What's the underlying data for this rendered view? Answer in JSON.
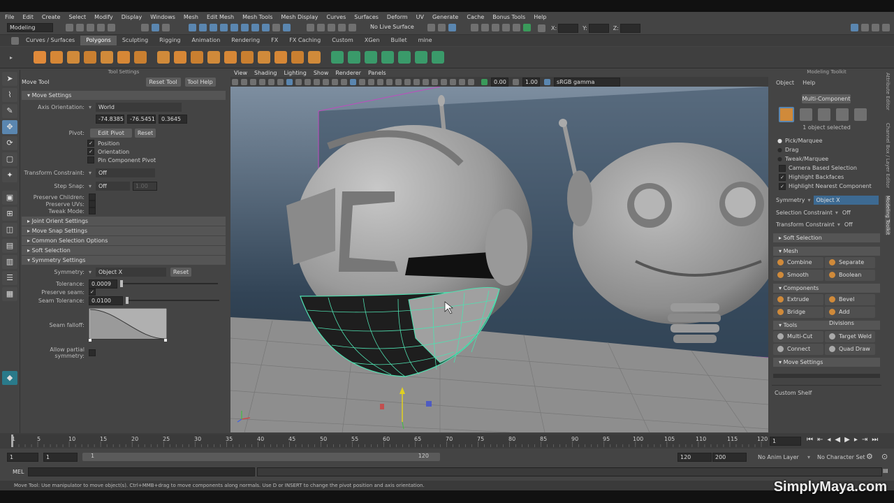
{
  "menubar": [
    "File",
    "Edit",
    "Create",
    "Select",
    "Modify",
    "Display",
    "Windows",
    "Mesh",
    "Edit Mesh",
    "Mesh Tools",
    "Mesh Display",
    "Curves",
    "Surfaces",
    "Deform",
    "UV",
    "Generate",
    "Cache",
    "Bonus Tools",
    "Help"
  ],
  "status": {
    "mode": "Modeling",
    "live_surface": "No Live Surface",
    "coord_x": "X:",
    "coord_y": "Y:",
    "coord_z": "Z:"
  },
  "shelf_tabs": [
    "Curves / Surfaces",
    "Polygons",
    "Sculpting",
    "Rigging",
    "Animation",
    "Rendering",
    "FX",
    "FX Caching",
    "Custom",
    "XGen",
    "Bullet",
    "mine"
  ],
  "active_shelf_tab": "Polygons",
  "tool_settings": {
    "panel_title": "Tool Settings",
    "tool_name": "Move Tool",
    "reset_tool": "Reset Tool",
    "tool_help": "Tool Help",
    "move_settings": "Move Settings",
    "axis_orientation_label": "Axis Orientation:",
    "axis_orientation_value": "World",
    "coords": [
      "-74.8385",
      "-76.5451",
      "0.3645"
    ],
    "pivot_label": "Pivot:",
    "edit_pivot": "Edit Pivot",
    "reset": "Reset",
    "position": "Position",
    "orientation": "Orientation",
    "pin_component_pivot": "Pin Component Pivot",
    "transform_constraint_label": "Transform Constraint:",
    "transform_constraint_value": "Off",
    "step_snap_label": "Step Snap:",
    "step_snap_value": "Off",
    "step_snap_amount": "1.00",
    "preserve_children": "Preserve Children:",
    "preserve_uvs": "Preserve UVs:",
    "tweak_mode": "Tweak Mode:",
    "joint_orient_settings": "Joint Orient Settings",
    "move_snap_settings": "Move Snap Settings",
    "common_selection_options": "Common Selection Options",
    "soft_selection": "Soft Selection",
    "symmetry_settings": "Symmetry Settings",
    "symmetry_label": "Symmetry:",
    "symmetry_value": "Object X",
    "symmetry_reset": "Reset",
    "tolerance_label": "Tolerance:",
    "tolerance_value": "0.0009",
    "preserve_seam_label": "Preserve seam:",
    "seam_tolerance_label": "Seam Tolerance:",
    "seam_tolerance_value": "0.0100",
    "seam_falloff_label": "Seam falloff:",
    "allow_partial_symmetry": "Allow partial symmetry:"
  },
  "viewport": {
    "menu": [
      "View",
      "Shading",
      "Lighting",
      "Show",
      "Renderer",
      "Panels"
    ],
    "exposure": "0.00",
    "gamma": "1.00",
    "colorspace": "sRGB gamma"
  },
  "modeling_toolkit": {
    "panel_title": "Modeling Toolkit",
    "menu": [
      "Object",
      "Help"
    ],
    "multi_component": "Multi-Component",
    "selection_count": "1 object selected",
    "pick_marquee": "Pick/Marquee",
    "drag": "Drag",
    "tweak_marquee": "Tweak/Marquee",
    "camera_based_selection": "Camera Based Selection",
    "highlight_backfaces": "Highlight Backfaces",
    "highlight_nearest_component": "Highlight Nearest Component",
    "symmetry_label": "Symmetry",
    "symmetry_value": "Object X",
    "selection_constraint_label": "Selection Constraint",
    "selection_constraint_value": "Off",
    "transform_constraint_label": "Transform Constraint",
    "transform_constraint_value": "Off",
    "soft_selection": "Soft Selection",
    "mesh_header": "Mesh",
    "mesh_buttons": [
      "Combine",
      "Separate",
      "Smooth",
      "Boolean"
    ],
    "components_header": "Components",
    "component_buttons": [
      "Extrude",
      "Bevel",
      "Bridge",
      "Add Divisions"
    ],
    "tools_header": "Tools",
    "tool_buttons": [
      "Multi-Cut",
      "Target Weld",
      "Connect",
      "Quad Draw"
    ],
    "move_settings": "Move Settings",
    "custom_shelf": "Custom Shelf"
  },
  "side_tabs": [
    "Attribute Editor",
    "Channel Box / Layer Editor",
    "Modeling Toolkit"
  ],
  "timeline": {
    "ticks": [
      "1",
      "5",
      "10",
      "15",
      "20",
      "25",
      "30",
      "35",
      "40",
      "45",
      "50",
      "55",
      "60",
      "65",
      "70",
      "75",
      "80",
      "85",
      "90",
      "95",
      "100",
      "105",
      "110",
      "115",
      "120"
    ],
    "current_frame": "1",
    "range_start": "1",
    "range_start2": "1",
    "range_inner_start": "1",
    "range_inner_end": "120",
    "range_end": "120",
    "anim_end": "200",
    "anim_layer": "No Anim Layer",
    "character_set": "No Character Set"
  },
  "cmdline": {
    "label": "MEL"
  },
  "helpline": "Move Tool: Use manipulator to move object(s). Ctrl+MMB+drag to move components along normals. Use D or INSERT to change the pivot position and axis orientation.",
  "watermark": "SimplyMaya.com",
  "colors": {
    "accent": "#5a86b0",
    "selection": "#4fe0b0",
    "orange_icon": "#d08a3a"
  }
}
